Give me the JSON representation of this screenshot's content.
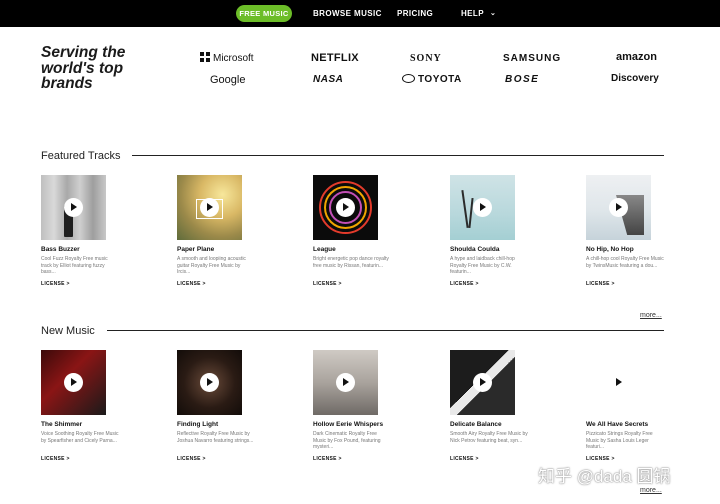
{
  "nav": {
    "free_music": "FREE MUSIC",
    "browse_music": "BROWSE MUSIC",
    "pricing": "PRICING",
    "help": "HELP",
    "accent_color": "#6cbd28"
  },
  "brands": {
    "title": "Serving the world's top brands",
    "logos": [
      "Microsoft",
      "NETFLIX",
      "SONY",
      "SAMSUNG",
      "amazon",
      "Google",
      "NASA",
      "TOYOTA",
      "BOSE",
      "Discovery"
    ]
  },
  "featured": {
    "title": "Featured Tracks",
    "more": "more...",
    "tracks": [
      {
        "title": "Bass Buzzer",
        "desc": "Cool Fuzz Royalty Free music track by Elliot featuring fuzzy bass...",
        "license": "LICENSE >"
      },
      {
        "title": "Paper Plane",
        "desc": "A smooth and loopiing acoustic guitar Royalty Free Music by Ircis...",
        "license": "LICENSE >"
      },
      {
        "title": "League",
        "desc": "Bright energetic pop dance royalty free music by Rissan, featurin...",
        "license": "LICENSE >"
      },
      {
        "title": "Shoulda Coulda",
        "desc": "A hype and laidback chill-hop Royalty Free Music by C.W. featurin...",
        "license": "LICENSE >"
      },
      {
        "title": "No Hip, No Hop",
        "desc": "A chill-hop cool Royalty Free Music by TwinsMusic featuring a dou...",
        "license": "LICENSE >"
      }
    ]
  },
  "new_music": {
    "title": "New Music",
    "more": "more...",
    "tracks": [
      {
        "title": "The Shimmer",
        "desc": "Voice Soothing Royalty Free Music by Spearfisher and Cicely Parna...",
        "license": "LICENSE >"
      },
      {
        "title": "Finding Light",
        "desc": "Reflective Royalty Free Music by Joshua Navarro featuring strings...",
        "license": "LICENSE >"
      },
      {
        "title": "Hollow Eerie Whispers",
        "desc": "Dark Cinematic Royalty Free Music by Fox Pound, featuring mysteri...",
        "license": "LICENSE >"
      },
      {
        "title": "Delicate Balance",
        "desc": "Smooth Airy Royalty Free Music by Nick Petrov featuring beat, syn...",
        "license": "LICENSE >"
      },
      {
        "title": "We All Have Secrets",
        "desc": "Pizzicato Strings Royalty Free Music by Sasha Louis Leger featuri...",
        "license": "LICENSE >"
      }
    ]
  },
  "watermark": "知乎 @dada 圆锅"
}
